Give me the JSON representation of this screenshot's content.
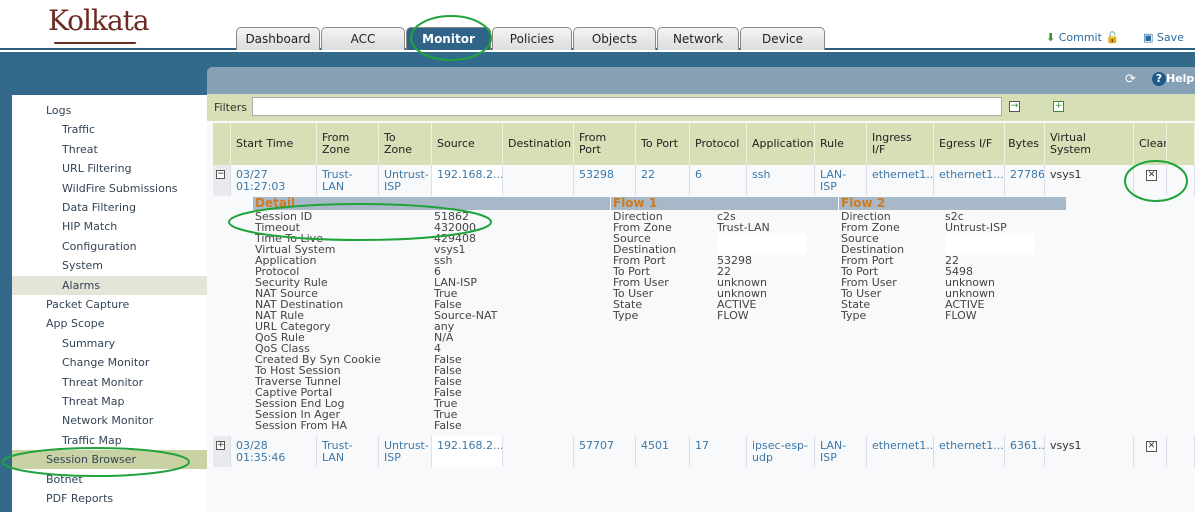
{
  "header": {
    "logo_text": "Kolkata",
    "tabs": [
      "Dashboard",
      "ACC",
      "Monitor",
      "Policies",
      "Objects",
      "Network",
      "Device"
    ],
    "active_tab": "Monitor",
    "commit": "Commit",
    "save": "Save",
    "help": "Help"
  },
  "sidebar": {
    "items": [
      {
        "label": "Logs",
        "level": 0
      },
      {
        "label": "Traffic",
        "level": 1
      },
      {
        "label": "Threat",
        "level": 1
      },
      {
        "label": "URL Filtering",
        "level": 1
      },
      {
        "label": "WildFire Submissions",
        "level": 1
      },
      {
        "label": "Data Filtering",
        "level": 1
      },
      {
        "label": "HIP Match",
        "level": 1
      },
      {
        "label": "Configuration",
        "level": 1
      },
      {
        "label": "System",
        "level": 1
      },
      {
        "label": "Alarms",
        "level": 1,
        "state": "hover"
      },
      {
        "label": "Packet Capture",
        "level": 0
      },
      {
        "label": "App Scope",
        "level": 0
      },
      {
        "label": "Summary",
        "level": 1
      },
      {
        "label": "Change Monitor",
        "level": 1
      },
      {
        "label": "Threat Monitor",
        "level": 1
      },
      {
        "label": "Threat Map",
        "level": 1
      },
      {
        "label": "Network Monitor",
        "level": 1
      },
      {
        "label": "Traffic Map",
        "level": 1
      },
      {
        "label": "Session Browser",
        "level": 0,
        "state": "selected"
      },
      {
        "label": "Botnet",
        "level": 0
      },
      {
        "label": "PDF Reports",
        "level": 0
      }
    ]
  },
  "filters": {
    "label": "Filters",
    "value": ""
  },
  "table": {
    "columns": [
      "Start Time",
      "From Zone",
      "To Zone",
      "Source",
      "Destination",
      "From Port",
      "To Port",
      "Protocol",
      "Application",
      "Rule",
      "Ingress I/F",
      "Egress I/F",
      "Bytes",
      "Virtual System",
      "Clear"
    ],
    "rows": [
      {
        "expanded": true,
        "cells": [
          "03/27 01:27:03",
          "Trust-LAN",
          "Untrust-ISP",
          "192.168.2....",
          "",
          "53298",
          "22",
          "6",
          "ssh",
          "LAN-ISP",
          "ethernet1...",
          "ethernet1...",
          "27786",
          "vsys1",
          ""
        ]
      },
      {
        "expanded": false,
        "cells": [
          "03/28 01:35:46",
          "Trust-LAN",
          "Untrust-ISP",
          "192.168.2....",
          "",
          "57707",
          "4501",
          "17",
          "ipsec-esp-udp",
          "LAN-ISP",
          "ethernet1...",
          "ethernet1...",
          "6361...",
          "vsys1",
          ""
        ]
      }
    ]
  },
  "detail": {
    "title": "Detail",
    "fields": [
      [
        "Session ID",
        "51862"
      ],
      [
        "Timeout",
        "432000"
      ],
      [
        "Time To Live",
        "429408"
      ],
      [
        "Virtual System",
        "vsys1"
      ],
      [
        "Application",
        "ssh"
      ],
      [
        "Protocol",
        "6"
      ],
      [
        "Security Rule",
        "LAN-ISP"
      ],
      [
        "NAT Source",
        "True"
      ],
      [
        "NAT Destination",
        "False"
      ],
      [
        "NAT Rule",
        "Source-NAT"
      ],
      [
        "URL Category",
        "any"
      ],
      [
        "QoS Rule",
        "N/A"
      ],
      [
        "QoS Class",
        "4"
      ],
      [
        "Created By Syn Cookie",
        "False"
      ],
      [
        "To Host Session",
        "False"
      ],
      [
        "Traverse Tunnel",
        "False"
      ],
      [
        "Captive Portal",
        "False"
      ],
      [
        "Session End Log",
        "True"
      ],
      [
        "Session In Ager",
        "True"
      ],
      [
        "Session From HA",
        "False"
      ]
    ]
  },
  "flow1": {
    "title": "Flow 1",
    "fields": [
      [
        "Direction",
        "c2s"
      ],
      [
        "From Zone",
        "Trust-LAN"
      ],
      [
        "Source",
        ""
      ],
      [
        "Destination",
        ""
      ],
      [
        "From Port",
        "53298"
      ],
      [
        "To Port",
        "22"
      ],
      [
        "From User",
        "unknown"
      ],
      [
        "To User",
        "unknown"
      ],
      [
        "State",
        "ACTIVE"
      ],
      [
        "Type",
        "FLOW"
      ]
    ]
  },
  "flow2": {
    "title": "Flow 2",
    "fields": [
      [
        "Direction",
        "s2c"
      ],
      [
        "From Zone",
        "Untrust-ISP"
      ],
      [
        "Source",
        ""
      ],
      [
        "Destination",
        ""
      ],
      [
        "From Port",
        "22"
      ],
      [
        "To Port",
        "5498"
      ],
      [
        "From User",
        "unknown"
      ],
      [
        "To User",
        "unknown"
      ],
      [
        "State",
        "ACTIVE"
      ],
      [
        "Type",
        "FLOW"
      ]
    ]
  },
  "colors": {
    "nav_blue": "#336a8c",
    "header_green": "#d6dfb6",
    "link": "#3c78a8",
    "annotation": "#1fa33a",
    "detail_title": "#d07a20"
  }
}
